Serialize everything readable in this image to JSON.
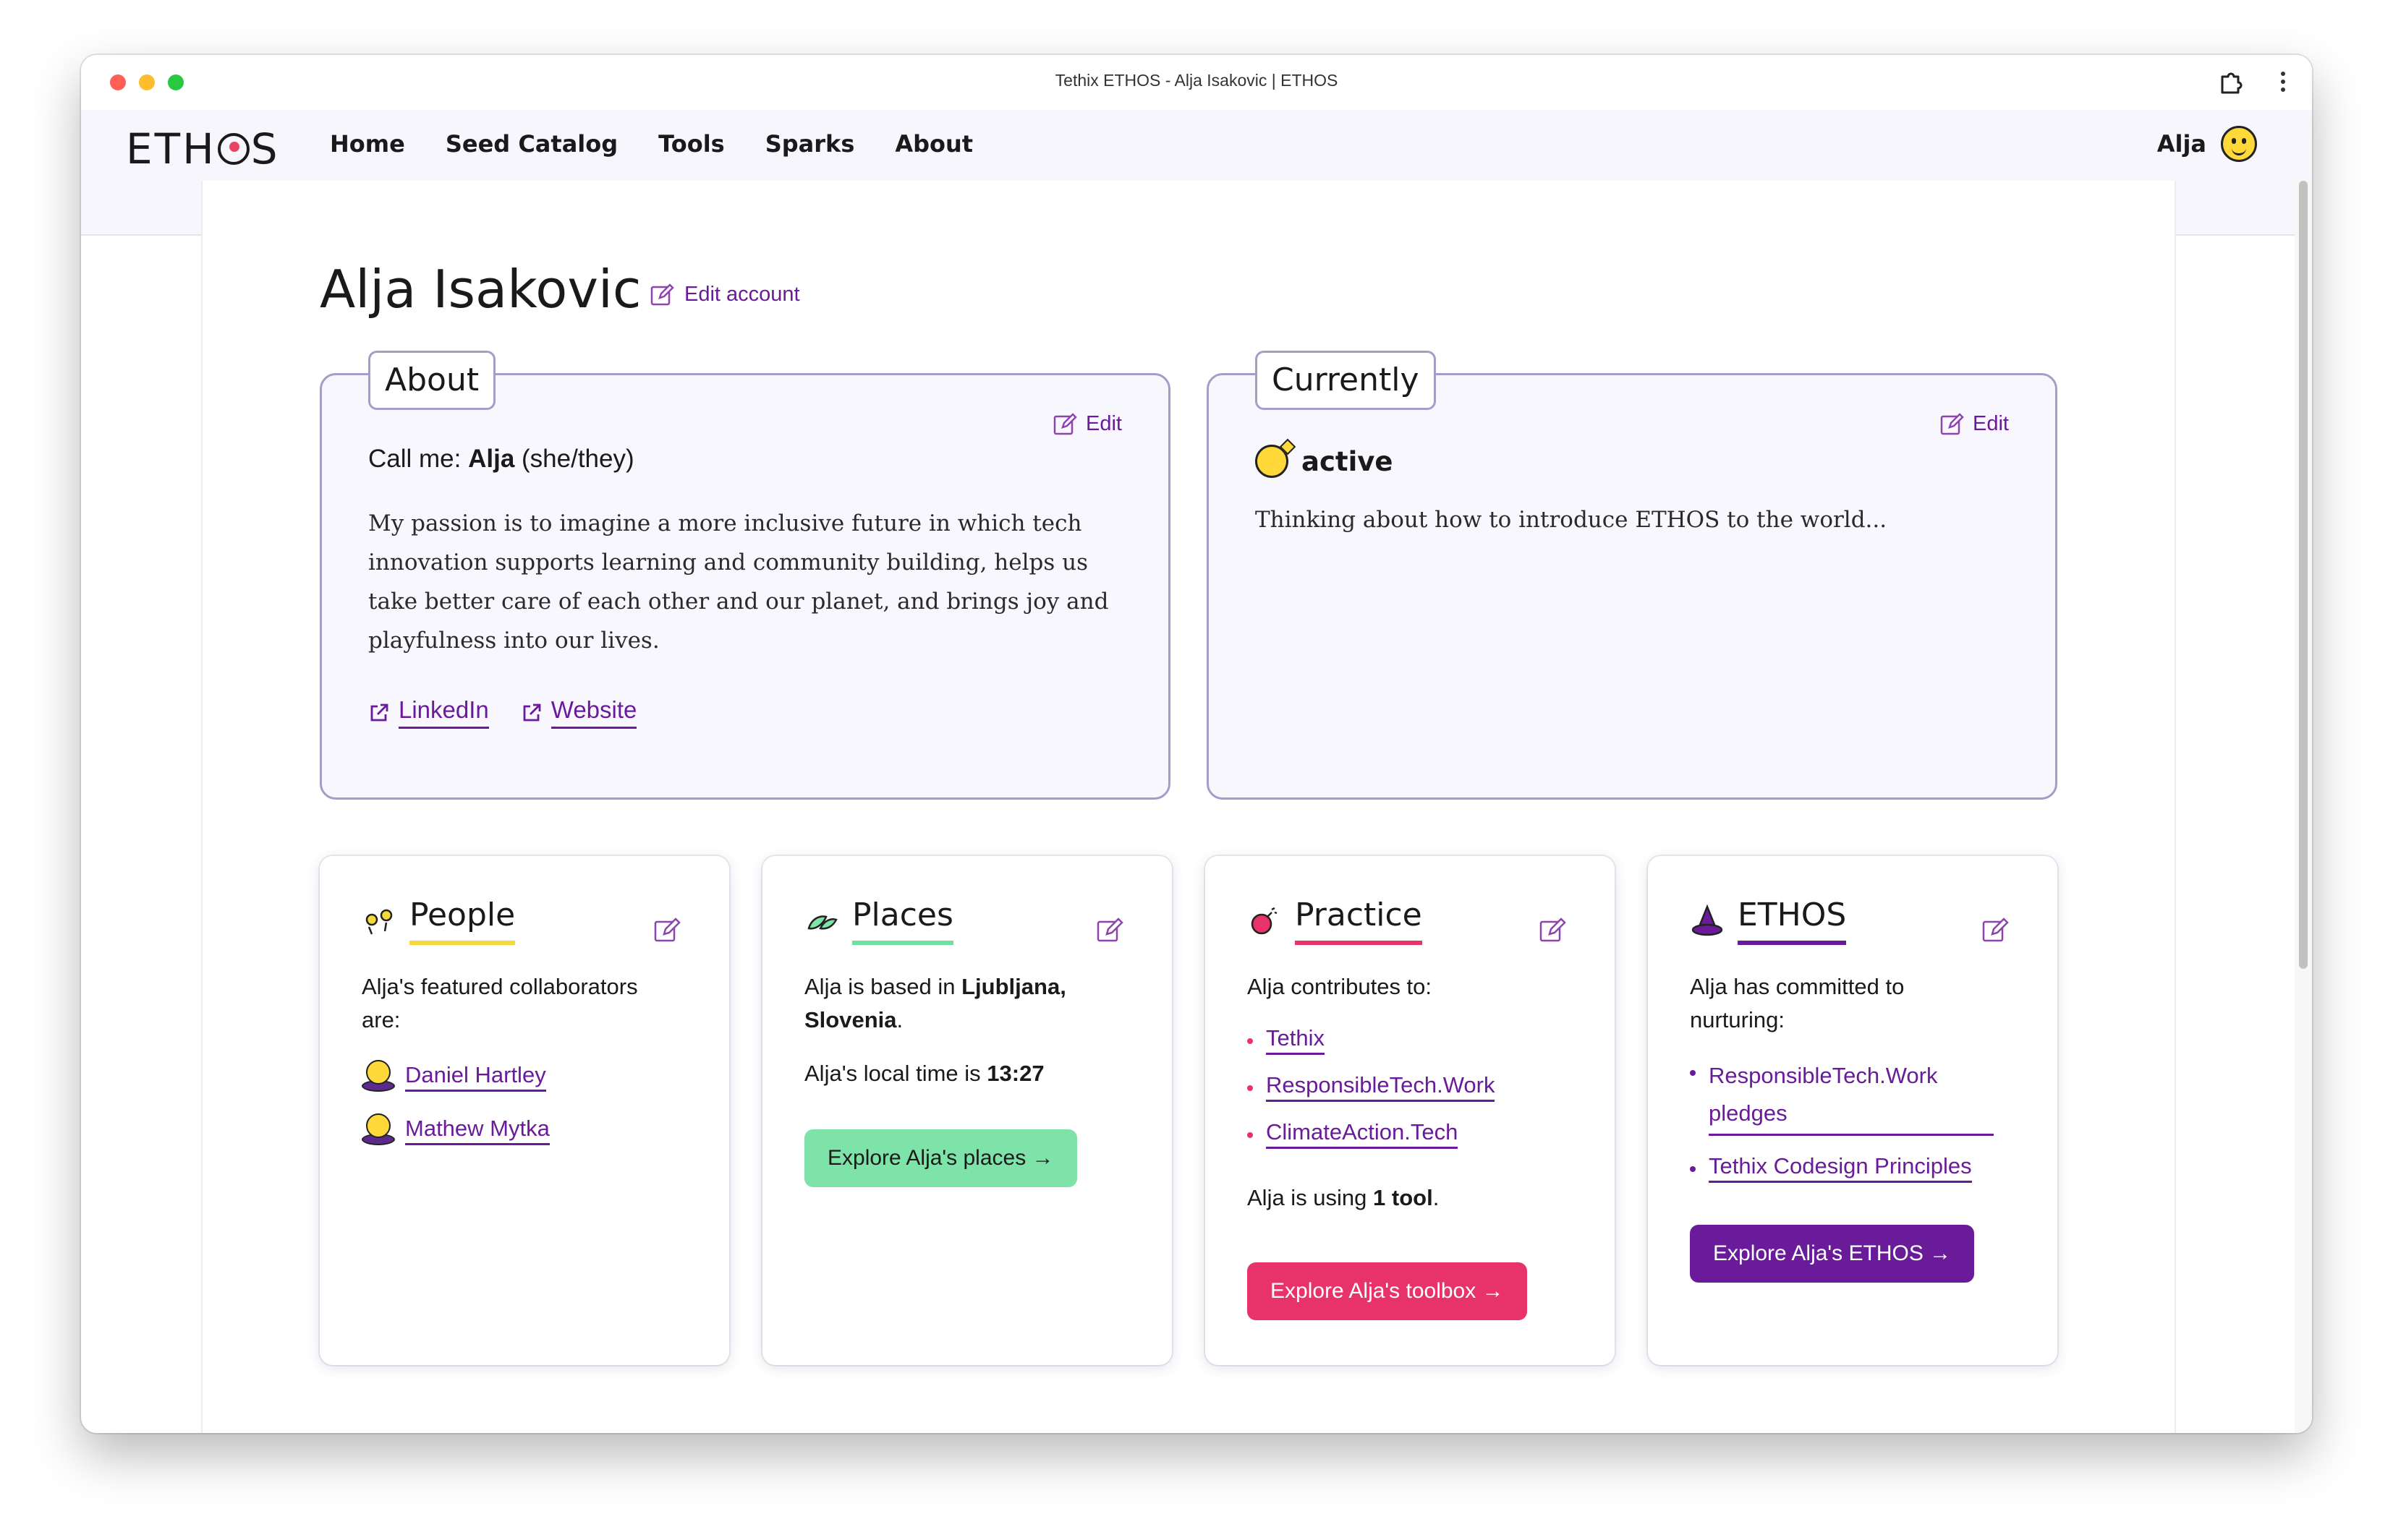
{
  "window": {
    "title": "Tethix ETHOS - Alja Isakovic | ETHOS"
  },
  "nav": {
    "logo": "ETH○S",
    "links": [
      "Home",
      "Seed Catalog",
      "Tools",
      "Sparks",
      "About"
    ],
    "user_name": "Alja"
  },
  "profile": {
    "name": "Alja Isakovic",
    "edit_account_label": "Edit account"
  },
  "about": {
    "tab": "About",
    "edit_label": "Edit",
    "call_me_prefix": "Call me: ",
    "call_me_name": "Alja",
    "pronouns": " (she/they)",
    "bio": "My passion is to imagine a more inclusive future in which tech innovation supports learning and community building, helps us take better care of each other and our planet, and brings joy and playfulness into our lives.",
    "links": [
      "LinkedIn",
      "Website"
    ]
  },
  "currently": {
    "tab": "Currently",
    "edit_label": "Edit",
    "status": "active",
    "text": "Thinking about how to introduce ETHOS to the world..."
  },
  "cards": {
    "people": {
      "title": "People",
      "intro": "Alja's featured collaborators are:",
      "collaborators": [
        "Daniel Hartley",
        "Mathew Mytka"
      ]
    },
    "places": {
      "title": "Places",
      "based_prefix": "Alja is based in ",
      "location": "Ljubljana, Slovenia",
      "based_suffix": ".",
      "time_prefix": "Alja's local time is ",
      "local_time": "13:27",
      "cta": "Explore Alja's places →"
    },
    "practice": {
      "title": "Practice",
      "intro": "Alja contributes to:",
      "contributions": [
        "Tethix",
        "ResponsibleTech.Work",
        "ClimateAction.Tech"
      ],
      "using_prefix": "Alja is using ",
      "using_count": "1 tool",
      "using_suffix": ".",
      "cta": "Explore Alja's toolbox →"
    },
    "ethos": {
      "title": "ETHOS",
      "intro": "Alja has committed to nurturing:",
      "commitments": [
        "ResponsibleTech.Work pledges",
        "Tethix Codesign Principles"
      ],
      "cta": "Explore Alja's ETHOS →"
    }
  },
  "colors": {
    "accent_purple": "#6a1b9a",
    "people_yellow": "#f5d83a",
    "places_green": "#7ee3a8",
    "practice_red": "#e8326a",
    "panel_border": "#a79bc7"
  }
}
